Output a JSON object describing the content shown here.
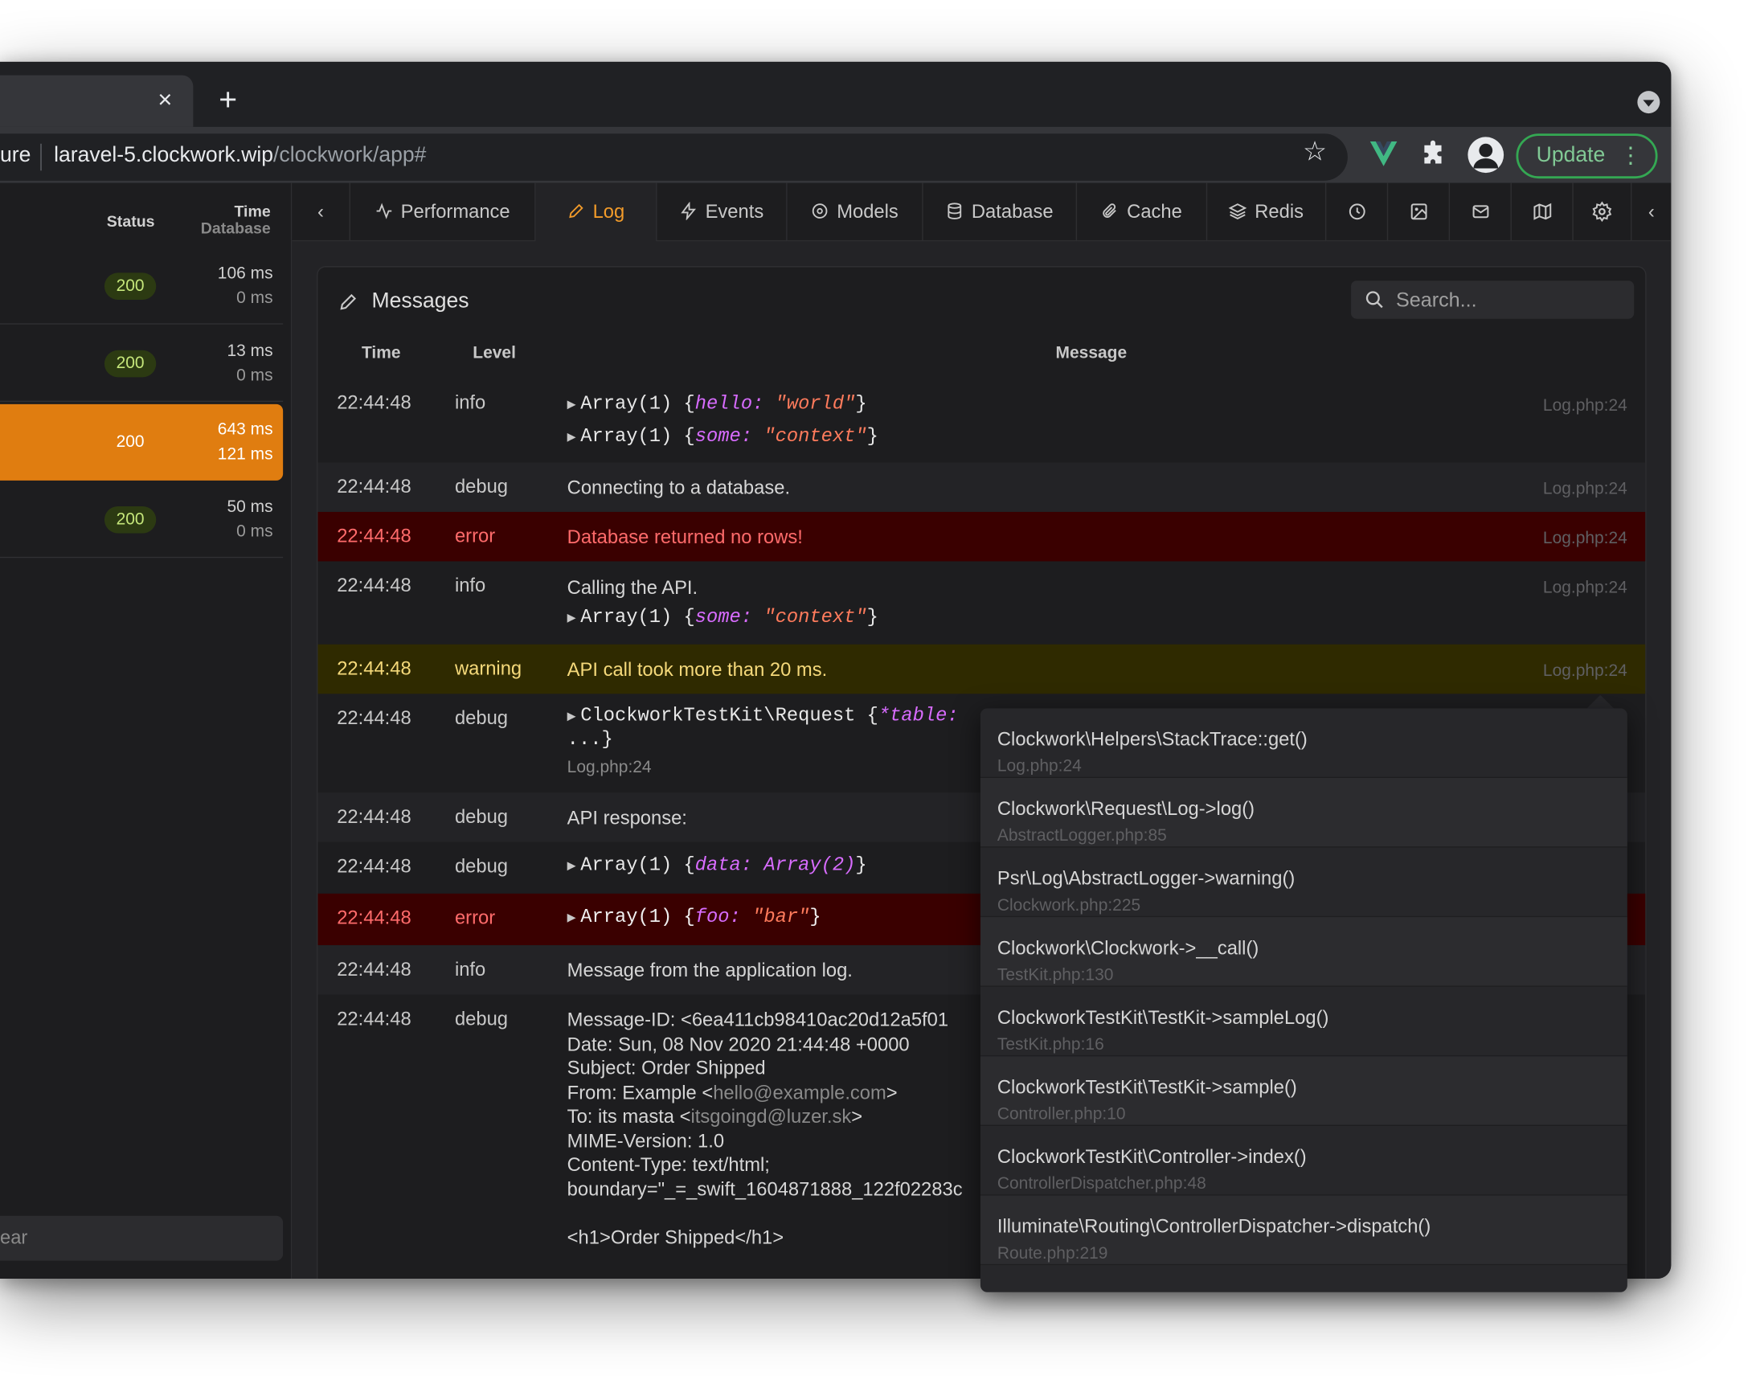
{
  "browser": {
    "new_tab_label": "+",
    "close_label": "×",
    "address": {
      "security_label": "ure",
      "host": "laravel-5.clockwork.wip",
      "path": "/clockwork/app#"
    },
    "update_label": "Update",
    "menu_label": "⋮"
  },
  "sidebar": {
    "header_status": "Status",
    "header_time": "Time",
    "header_database": "Database",
    "requests": [
      {
        "status": "200",
        "time": "106 ms",
        "database": "0 ms",
        "active": false
      },
      {
        "status": "200",
        "time": "13 ms",
        "database": "0 ms",
        "active": false
      },
      {
        "status": "200",
        "time": "643 ms",
        "database": "121 ms",
        "active": true
      },
      {
        "status": "200",
        "time": "50 ms",
        "database": "0 ms",
        "active": false
      }
    ],
    "search_text": "ear"
  },
  "nav": {
    "tabs": [
      {
        "label": "Performance",
        "icon": "activity-icon"
      },
      {
        "label": "Log",
        "icon": "pencil-icon",
        "active": true
      },
      {
        "label": "Events",
        "icon": "zap-icon"
      },
      {
        "label": "Models",
        "icon": "disc-icon"
      },
      {
        "label": "Database",
        "icon": "database-icon"
      },
      {
        "label": "Cache",
        "icon": "paperclip-icon"
      },
      {
        "label": "Redis",
        "icon": "layers-icon"
      }
    ],
    "icon_tabs": [
      "clock-icon",
      "image-icon",
      "mail-icon",
      "map-icon",
      "settings-icon"
    ]
  },
  "panel": {
    "title": "Messages",
    "search_placeholder": "Search...",
    "columns": {
      "time": "Time",
      "level": "Level",
      "message": "Message"
    },
    "rows": [
      {
        "time": "22:44:48",
        "level": "info",
        "type": "info",
        "file": "Log.php:24"
      },
      {
        "time": "22:44:48",
        "level": "debug",
        "type": "debug",
        "message": "Connecting to a database.",
        "file": "Log.php:24"
      },
      {
        "time": "22:44:48",
        "level": "error",
        "type": "error",
        "message": "Database returned no rows!",
        "file": "Log.php:24"
      },
      {
        "time": "22:44:48",
        "level": "info",
        "type": "info",
        "message": "Calling the API.",
        "file": "Log.php:24"
      },
      {
        "time": "22:44:48",
        "level": "warning",
        "type": "warning",
        "message": "API call took more than 20 ms.",
        "file": "Log.php:24"
      },
      {
        "time": "22:44:48",
        "level": "debug",
        "type": "debug",
        "file": "Log.php:24"
      },
      {
        "time": "22:44:48",
        "level": "debug",
        "type": "debug",
        "message": "API response:"
      },
      {
        "time": "22:44:48",
        "level": "debug",
        "type": "debug"
      },
      {
        "time": "22:44:48",
        "level": "error",
        "type": "error"
      },
      {
        "time": "22:44:48",
        "level": "info",
        "type": "info",
        "message": "Message from the application log."
      },
      {
        "time": "22:44:48",
        "level": "debug",
        "type": "debug"
      }
    ],
    "array_label": "Array(1)",
    "array2_label": "Array(2)",
    "req_class": "ClockworkTestKit\\Request",
    "req_key": "*table:",
    "req_more": "...}",
    "kv": {
      "hello_key": "hello:",
      "hello_val": "\"world\"",
      "some_key": "some:",
      "some_val": "\"context\"",
      "data_key": "data:",
      "foo_key": "foo:",
      "foo_val": "\"bar\""
    },
    "email": {
      "line1": "Message-ID: <6ea411cb98410ac20d12a5f01",
      "line2": "Date: Sun, 08 Nov 2020 21:44:48 +0000",
      "line3": "Subject: Order Shipped",
      "from_prefix": "From: Example <",
      "from_addr": "hello@example.com",
      "from_suffix": ">",
      "to_prefix": "To: its masta <",
      "to_addr": "itsgoingd@luzer.sk",
      "to_suffix": ">",
      "line6": "MIME-Version: 1.0",
      "line7": "Content-Type: text/html;",
      "line8": "boundary=\"_=_swift_1604871888_122f02283c",
      "line9": "<h1>Order Shipped</h1>"
    }
  },
  "stack_trace": [
    {
      "call": "Clockwork\\Helpers\\StackTrace::get()",
      "file": "Log.php:24"
    },
    {
      "call": "Clockwork\\Request\\Log->log()",
      "file": "AbstractLogger.php:85"
    },
    {
      "call": "Psr\\Log\\AbstractLogger->warning()",
      "file": "Clockwork.php:225"
    },
    {
      "call": "Clockwork\\Clockwork->__call()",
      "file": "TestKit.php:130"
    },
    {
      "call": "ClockworkTestKit\\TestKit->sampleLog()",
      "file": "TestKit.php:16"
    },
    {
      "call": "ClockworkTestKit\\TestKit->sample()",
      "file": "Controller.php:10"
    },
    {
      "call": "ClockworkTestKit\\Controller->index()",
      "file": "ControllerDispatcher.php:48"
    },
    {
      "call": "Illuminate\\Routing\\ControllerDispatcher->dispatch()",
      "file": "Route.php:219"
    }
  ],
  "colors": {
    "accent": "#f29b2a",
    "active_request": "#e07d10",
    "error_row": "#3a0000",
    "warning_row": "#2f2a00",
    "status_badge": "#c5e67a",
    "update_green": "#34a853"
  }
}
